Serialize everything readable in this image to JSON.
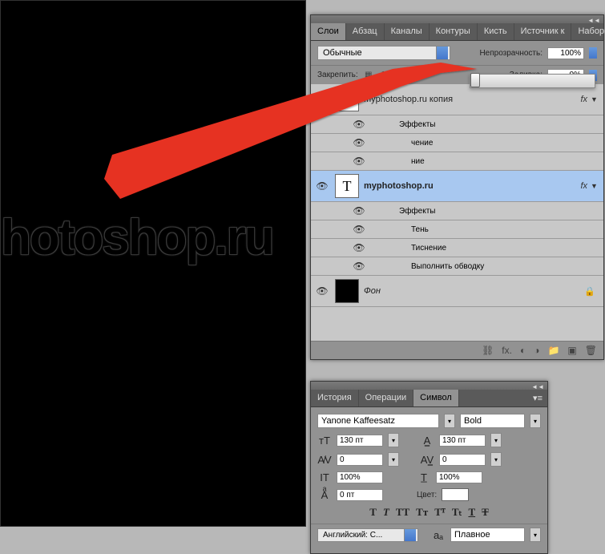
{
  "canvas": {
    "text": "hotoshop.ru"
  },
  "layers_panel": {
    "tabs": [
      "Слои",
      "Абзац",
      "Каналы",
      "Контуры",
      "Кисть",
      "Источник к",
      "Наборы ки"
    ],
    "active_tab": 0,
    "blend_mode": "Обычные",
    "opacity_label": "Непрозрачность:",
    "opacity_value": "100%",
    "lock_label": "Закрепить:",
    "fill_label": "Заливка:",
    "fill_value": "0%",
    "layers": [
      {
        "name": "myphotoshop.ru копия",
        "type": "text",
        "visible": true,
        "fx": true
      },
      {
        "name": "Эффекты",
        "type": "effect-header",
        "visible": true
      },
      {
        "name": "чение",
        "type": "effect",
        "visible": true
      },
      {
        "name": "ние",
        "type": "effect",
        "visible": true
      },
      {
        "name": "myphotoshop.ru",
        "type": "text",
        "visible": true,
        "fx": true,
        "selected": true,
        "bold": true
      },
      {
        "name": "Эффекты",
        "type": "effect-header",
        "visible": true
      },
      {
        "name": "Тень",
        "type": "effect",
        "visible": true
      },
      {
        "name": "Тиснение",
        "type": "effect",
        "visible": true
      },
      {
        "name": "Выполнить обводку",
        "type": "effect",
        "visible": true
      },
      {
        "name": "Фон",
        "type": "bg",
        "visible": true,
        "locked": true
      }
    ]
  },
  "char_panel": {
    "tabs": [
      "История",
      "Операции",
      "Символ"
    ],
    "active_tab": 2,
    "font": "Yanone Kaffeesatz",
    "weight": "Bold",
    "size": "130 пт",
    "leading": "130 пт",
    "kerning": "0",
    "tracking": "0",
    "vscale": "100%",
    "hscale": "100%",
    "baseline": "0 пт",
    "color_label": "Цвет:",
    "language": "Английский: С...",
    "aa_label": "aₐ",
    "aa_value": "Плавное"
  }
}
